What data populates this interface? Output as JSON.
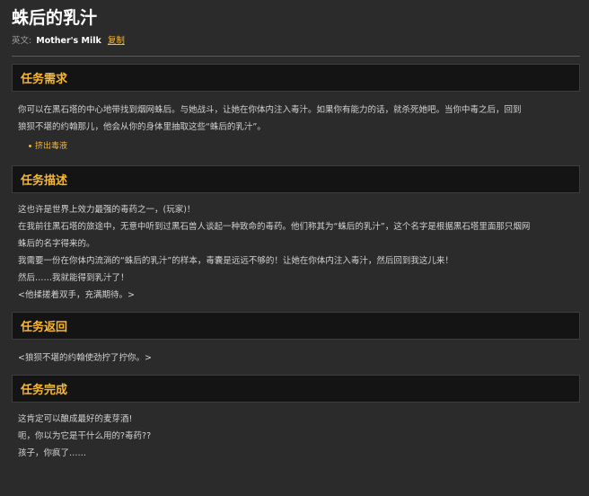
{
  "quest": {
    "title": "蛛后的乳汁",
    "english_label": "英文:",
    "english_name": "Mother's Milk",
    "copy_label": "复制"
  },
  "sections": {
    "requirement": {
      "header": "任务需求",
      "lines": [
        "你可以在黑石塔的中心地带找到烟网蛛后。与她战斗，让她在你体内注入毒汁。如果你有能力的话，就杀死她吧。当你中毒之后，回到",
        "狼狈不堪的约翰那儿，他会从你的身体里抽取这些“蛛后的乳汁”。"
      ],
      "objectives": [
        "挤出毒液"
      ]
    },
    "description": {
      "header": "任务描述",
      "lines": [
        "这也许是世界上效力最强的毒药之一，(玩家)！",
        "在我前往黑石塔的旅途中，无意中听到过黑石兽人谈起一种致命的毒药。他们称其为“蛛后的乳汁”，这个名字是根据黑石塔里面那只烟网",
        "蛛后的名字得来的。",
        "我需要一份在你体内流淌的“蛛后的乳汁”的样本，毒囊是远远不够的！让她在你体内注入毒汁，然后回到我这儿来！",
        "然后……我就能得到乳汁了！",
        "<他揉搓着双手，充满期待。>"
      ]
    },
    "return": {
      "header": "任务返回",
      "lines": [
        "<狼狈不堪的约翰使劲拧了拧你。>"
      ]
    },
    "complete": {
      "header": "任务完成",
      "lines": [
        "这肯定可以酿成最好的麦芽酒!",
        "呃，你以为它是干什么用的?毒药??",
        "孩子，你疯了……"
      ]
    }
  },
  "colors": {
    "background": "#2b2b2b",
    "header_background": "#141414",
    "accent": "#f7b731",
    "title_text": "#ffffff",
    "body_text": "#d2d2d2"
  }
}
